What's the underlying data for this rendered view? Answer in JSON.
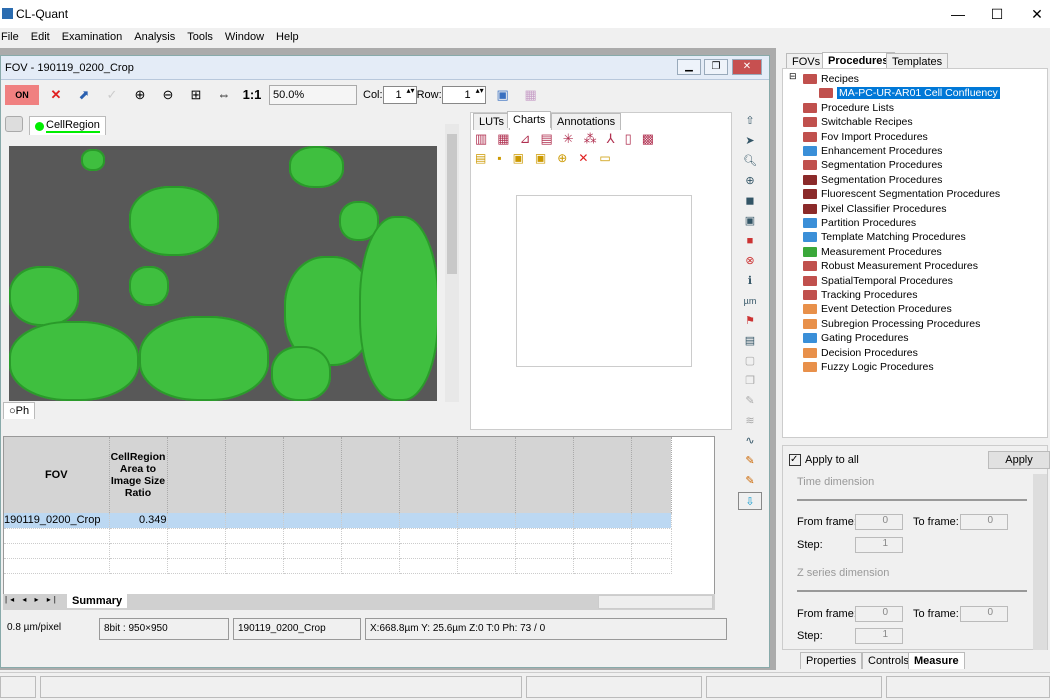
{
  "app": {
    "title": "CL-Quant",
    "minimize": "—",
    "maximize": "☐",
    "close": "✕"
  },
  "menu": [
    "File",
    "Edit",
    "Examination",
    "Analysis",
    "Tools",
    "Window",
    "Help"
  ],
  "fov": {
    "title": "FOV - 190119_0200_Crop",
    "toolbar": {
      "on_label": "ON",
      "one_to_one": "1:1",
      "zoom": "50.0%",
      "col_label": "Col:",
      "col_value": "1",
      "row_label": "Row:",
      "row_value": "1"
    },
    "layer_tab": "CellRegion",
    "phase_tab": "Ph",
    "chart_tabs": [
      "LUTs",
      "Charts",
      "Annotations"
    ],
    "table": {
      "headers": [
        "FOV",
        "CellRegion Area to Image Size Ratio"
      ],
      "rows": [
        [
          "190119_0200_Crop",
          "0.349"
        ]
      ]
    },
    "sheet_tab": "Summary",
    "status": {
      "scale": "0.8  µm/pixel",
      "bitdepth": "8bit : 950×950",
      "name": "190119_0200_Crop",
      "coords": "X:668.8µm  Y: 25.6µm  Z:0  T:0 Ph: 73 / 0"
    }
  },
  "right": {
    "tabs": [
      "FOVs",
      "Procedures",
      "Templates"
    ],
    "tree": [
      {
        "label": "Recipes",
        "color": "#c0504d",
        "level": 0
      },
      {
        "label": "MA-PC-UR-AR01 Cell Confluency",
        "color": "#c0504d",
        "level": 1,
        "selected": true
      },
      {
        "label": "Procedure Lists",
        "color": "#c0504d",
        "level": 0
      },
      {
        "label": "Switchable Recipes",
        "color": "#c0504d",
        "level": 0
      },
      {
        "label": "Fov Import Procedures",
        "color": "#c0504d",
        "level": 0
      },
      {
        "label": "Enhancement Procedures",
        "color": "#3a8fd8",
        "level": 0
      },
      {
        "label": "Segmentation Procedures",
        "color": "#c0504d",
        "level": 0
      },
      {
        "label": "Segmentation Procedures",
        "color": "#8b2a2a",
        "level": 0
      },
      {
        "label": "Fluorescent Segmentation Procedures",
        "color": "#8b2a2a",
        "level": 0
      },
      {
        "label": "Pixel Classifier Procedures",
        "color": "#8b2a2a",
        "level": 0
      },
      {
        "label": "Partition Procedures",
        "color": "#3a8fd8",
        "level": 0
      },
      {
        "label": "Template Matching Procedures",
        "color": "#3a8fd8",
        "level": 0
      },
      {
        "label": "Measurement Procedures",
        "color": "#3aa83a",
        "level": 0
      },
      {
        "label": "Robust Measurement Procedures",
        "color": "#c0504d",
        "level": 0
      },
      {
        "label": "SpatialTemporal Procedures",
        "color": "#c0504d",
        "level": 0
      },
      {
        "label": "Tracking Procedures",
        "color": "#c0504d",
        "level": 0
      },
      {
        "label": "Event Detection Procedures",
        "color": "#e8904a",
        "level": 0
      },
      {
        "label": "Subregion Processing Procedures",
        "color": "#e8904a",
        "level": 0
      },
      {
        "label": "Gating Procedures",
        "color": "#3a8fd8",
        "level": 0
      },
      {
        "label": "Decision Procedures",
        "color": "#e8904a",
        "level": 0
      },
      {
        "label": "Fuzzy Logic Procedures",
        "color": "#e8904a",
        "level": 0
      }
    ],
    "controls": {
      "apply_all": "Apply to all",
      "apply": "Apply",
      "time_dim": "Time dimension",
      "z_dim": "Z series dimension",
      "from": "From frame:",
      "to": "To frame:",
      "step": "Step:",
      "from_val": "0",
      "to_val": "0",
      "step_val": "1",
      "z_from_val": "0",
      "z_to_val": "0",
      "z_step_val": "1"
    },
    "bottom_tabs": [
      "Properties",
      "Controls",
      "Measure"
    ]
  }
}
